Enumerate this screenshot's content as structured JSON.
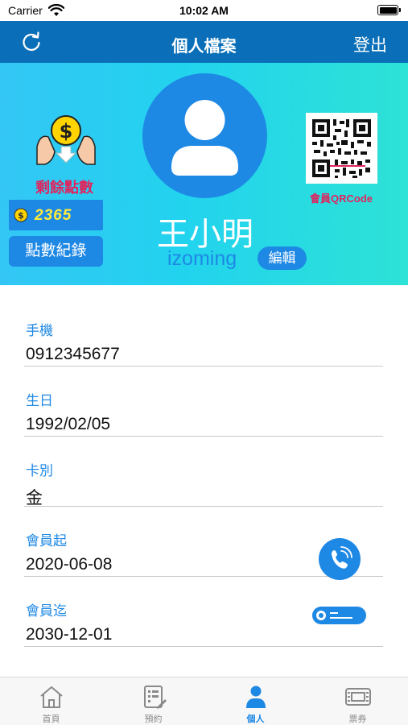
{
  "status_bar": {
    "carrier": "Carrier",
    "time": "10:02 AM"
  },
  "nav": {
    "title": "個人檔案",
    "logout_label": "登出"
  },
  "header": {
    "points_label": "剩餘點數",
    "points_value": "2365",
    "points_record_label": "點數紀錄",
    "user_name": "王小明",
    "user_id": "izoming",
    "edit_label": "編輯",
    "qr_label": "會員QRCode"
  },
  "fields": [
    {
      "label": "手機",
      "value": "0912345677"
    },
    {
      "label": "生日",
      "value": "1992/02/05"
    },
    {
      "label": "卡別",
      "value": "金"
    },
    {
      "label": "會員起",
      "value": "2020-06-08"
    },
    {
      "label": "會員迄",
      "value": "2030-12-01"
    }
  ],
  "tabs": [
    {
      "label": "首頁",
      "icon": "home-icon"
    },
    {
      "label": "預約",
      "icon": "booking-icon"
    },
    {
      "label": "個人",
      "icon": "person-icon",
      "active": true
    },
    {
      "label": "票券",
      "icon": "ticket-icon"
    }
  ],
  "colors": {
    "nav": "#0a6fb8",
    "accent": "#1e88e5",
    "points_label": "#e0245e",
    "header_from": "#33c6f5",
    "header_to": "#2de2d6"
  }
}
